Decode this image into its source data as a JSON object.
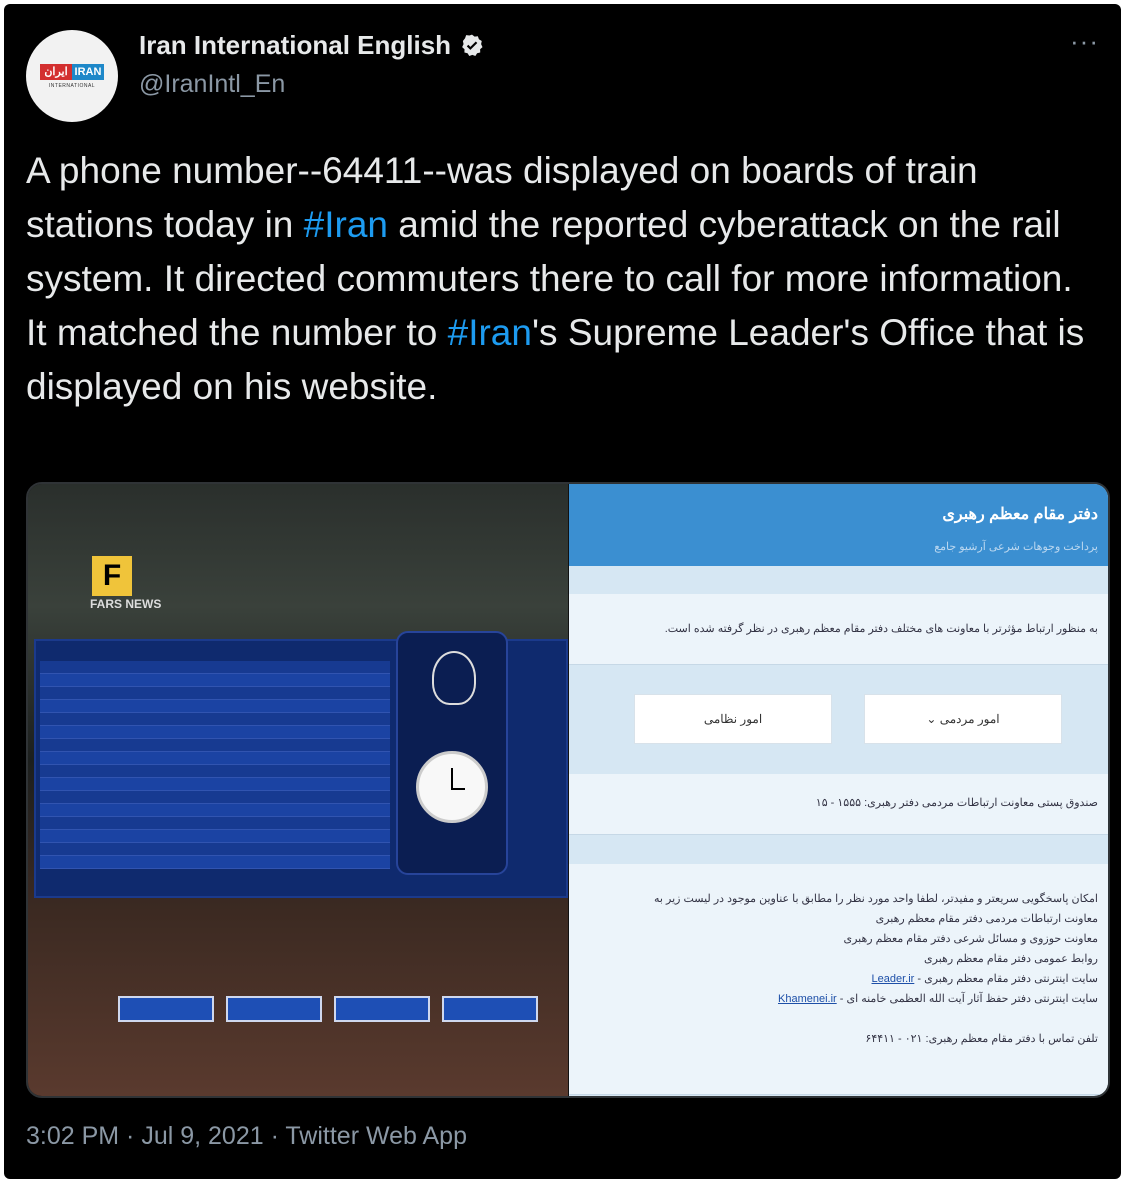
{
  "tweet": {
    "display_name": "Iran International English",
    "handle": "@IranIntl_En",
    "avatar_logo": {
      "fa": "ایران",
      "en": "IRAN",
      "sub": "INTERNATIONAL"
    },
    "more_label": "···",
    "text_parts": [
      "A phone number--64411--was displayed on boards of train stations today in ",
      "#Iran",
      " amid the reported cyberattack on the rail system. It directed commuters there to call for more information. It matched the number to ",
      "#Iran",
      "'s Supreme Leader's Office that is displayed on his website."
    ],
    "footer": "3:02 PM · Jul 9, 2021 · Twitter Web App"
  },
  "media": {
    "left_photo": {
      "watermark": "F",
      "watermark_text": "FARS NEWS"
    },
    "right_screenshot": {
      "site_title": "دفتر مقام معظم رهبری",
      "site_nav": "پرداخت وجوهات شرعی    آرشیو جامع",
      "intro": "به منظور ارتباط مؤثرتر با معاونت های مختلف دفتر مقام معظم رهبری در نظر گرفته شده است.",
      "btn_1": "امور مردمی ⌄",
      "btn_2": "امور نظامی",
      "postal": "صندوق پستی معاونت ارتباطات مردمی دفتر رهبری: ۱۵۵۵ - ۱۵",
      "lines": [
        "امکان پاسخگویی سریعتر و مفیدتر، لطفا واحد مورد نظر را مطابق با عناوین موجود در لیست زیر به",
        "معاونت ارتباطات مردمی دفتر مقام معظم رهبری",
        "معاونت حوزوی و مسائل شرعی دفتر مقام معظم رهبری",
        "روابط عمومی دفتر مقام معظم رهبری",
        "سایت اینترنتی دفتر مقام معظم رهبری -",
        "سایت اینترنتی دفتر حفظ آثار آیت الله العظمی خامنه ای -"
      ],
      "link_1": "Leader.ir",
      "link_2": "Khamenei.ir",
      "phone_line": "تلفن تماس با دفتر مقام معظم رهبری: ۰۲۱ - ۶۴۴۱۱"
    }
  },
  "colors": {
    "background": "#000000",
    "text": "#e7e9ea",
    "secondary": "#8b98a5",
    "hashtag": "#1d9bf0",
    "verified": "#e7e9ea"
  }
}
